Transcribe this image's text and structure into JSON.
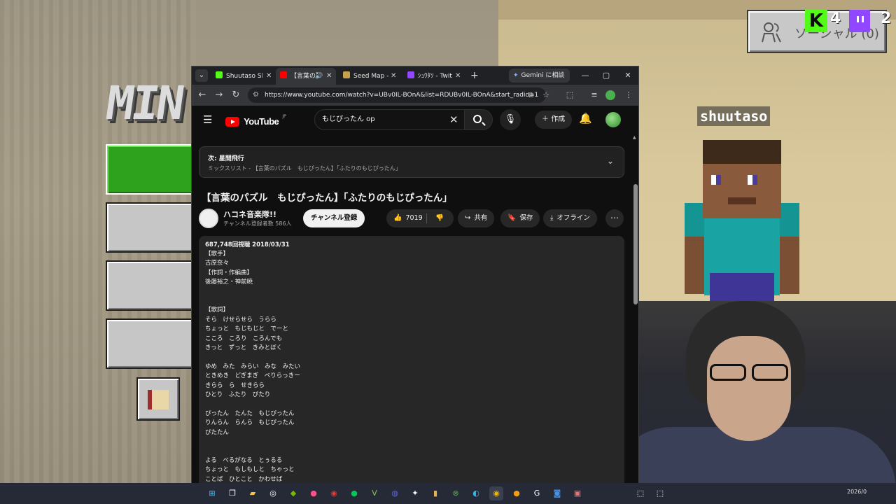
{
  "overlay": {
    "social_label": "ソーシャル (0)",
    "kick_count": "4",
    "twitch_count": "2",
    "player_name": "shuutaso",
    "logo_text": "MIN"
  },
  "browser": {
    "tabs": [
      {
        "title": "Shuutaso Sh",
        "favicon_color": "#53fc18",
        "active": false
      },
      {
        "title": "【言葉の】",
        "favicon_color": "#ff0000",
        "active": true,
        "audio": true
      },
      {
        "title": "Seed Map - ",
        "favicon_color": "#c8a24a",
        "active": false
      },
      {
        "title": "ｼｭｳﾀｿ - Twit",
        "favicon_color": "#9146ff",
        "active": false
      }
    ],
    "new_tab": "+",
    "gemini_label": "Gemini に相談",
    "url": "https://www.youtube.com/watch?v=UBv0IL-BOnA&list=RDUBv0IL-BOnA&start_radio=1"
  },
  "youtube": {
    "logo": "YouTube",
    "region": "JP",
    "search_query": "もじぴったん op",
    "create_label": "作成",
    "playlist": {
      "next": "次: 星間飛行",
      "mix": "ミックスリスト - 【言葉のパズル　もじぴったん】「ふたりのもじぴったん」"
    },
    "video_title": "【言葉のパズル　もじぴったん】「ふたりのもじぴったん」",
    "channel_name": "ハコネ音楽隊!!",
    "channel_subs": "チャンネル登録者数 586人",
    "subscribe_label": "チャンネル登録",
    "like_count": "7019",
    "share_label": "共有",
    "save_label": "保存",
    "offline_label": "オフライン",
    "description_meta": "687,748回視聴  2018/03/31",
    "description_lines": [
      "【歌手】",
      "古原奈々",
      "【作詞・作編曲】",
      "後藤裕之・神前暁",
      "",
      "",
      "【歌詞】",
      "そら　けせらせら　うらら",
      "ちょっと　もじもじと　でーと",
      "こころ　ころり　ころんでも",
      "きっと　ずっと　きみとぼく",
      "",
      "ゆめ　みた　みらい　みな　みたい",
      "ときめき　どぎまぎ　べりらっきー",
      "きらら　ら　せきらら",
      "ひとり　ふたり　ぴたり",
      "",
      "ぴったん　たんた　もじぴったん",
      "りんらん　らんら　もじぴったん",
      "ぴたたん",
      "",
      "",
      "よる　べるがなる　とぅるる",
      "ちょっと　もしもしと　ちゃっと",
      "ことば　ひとこと　かわせば"
    ]
  },
  "taskbar": {
    "clock": "2026/0"
  },
  "colors": {
    "youtube_red": "#ff0000",
    "kick_green": "#53fc18",
    "twitch_purple": "#9146ff",
    "mc_green_button": "#2ea21d"
  }
}
